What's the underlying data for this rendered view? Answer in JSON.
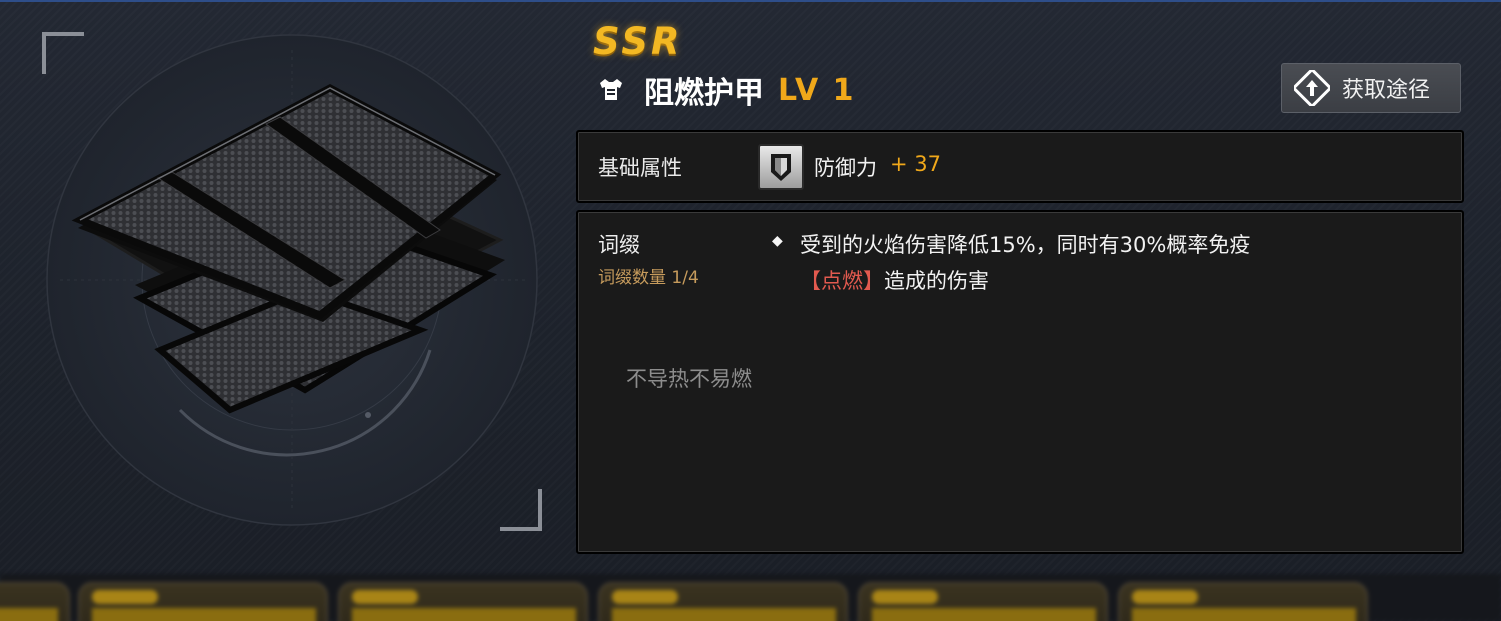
{
  "item": {
    "rarity": "SSR",
    "name": "阻燃护甲",
    "level": "LV 1",
    "icon": "armor-icon",
    "rarity_color": "#f3b823",
    "level_color": "#f0a81a"
  },
  "actions": {
    "source_label": "获取途径",
    "source_icon": "route-diamond-icon"
  },
  "base_attributes": {
    "label": "基础属性",
    "stat_icon": "shield-icon",
    "stat_name": "防御力",
    "stat_value": "+ 37"
  },
  "affix": {
    "title": "词缀",
    "count": "词缀数量 1/4",
    "bullet": "◆",
    "effect_line1": "受到的火焰伤害降低15%，同时有30%概率免疫",
    "effect_keyword": "【点燃】",
    "effect_rest": "造成的伤害",
    "keyword_color": "#e35a4f",
    "flavor": "不导热不易燃"
  }
}
